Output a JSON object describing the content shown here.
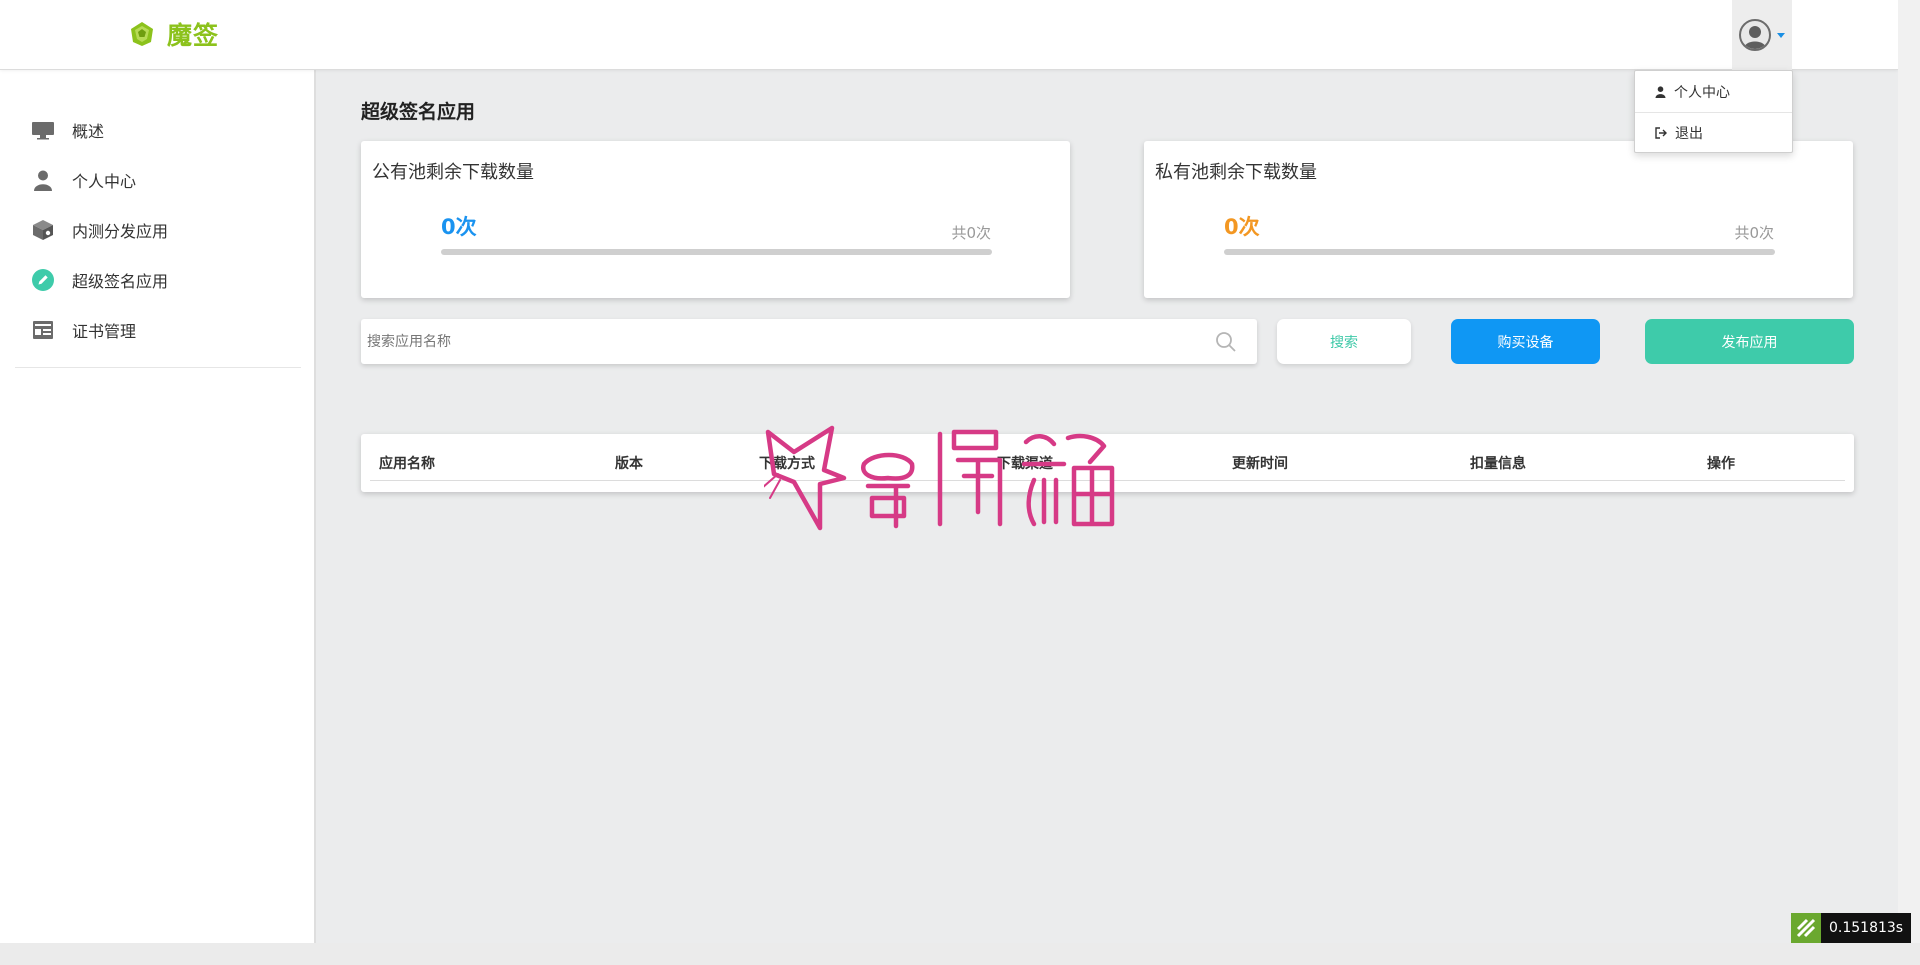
{
  "app": {
    "name": "魔签",
    "brand_color": "#8cc21c"
  },
  "user_menu": {
    "items": [
      {
        "label": "个人中心",
        "icon": "user-icon"
      },
      {
        "label": "退出",
        "icon": "logout-icon"
      }
    ]
  },
  "sidebar": {
    "items": [
      {
        "label": "概述",
        "icon": "monitor-icon"
      },
      {
        "label": "个人中心",
        "icon": "user-icon"
      },
      {
        "label": "内测分发应用",
        "icon": "box-icon"
      },
      {
        "label": "超级签名应用",
        "icon": "pencil-icon",
        "active": true
      },
      {
        "label": "证书管理",
        "icon": "certificate-icon"
      }
    ]
  },
  "main": {
    "title": "超级签名应用",
    "public_pool": {
      "title": "公有池剩余下载数量",
      "count": "0次",
      "total": "共0次",
      "color": "#1a93f0",
      "fill": 0
    },
    "private_pool": {
      "title": "私有池剩余下载数量",
      "count": "0次",
      "total": "共0次",
      "color": "#f39722",
      "fill": 0
    },
    "search": {
      "placeholder": "搜索应用名称",
      "value": ""
    },
    "buttons": {
      "search": "搜索",
      "buy": "购买设备",
      "publish": "发布应用"
    },
    "table": {
      "columns": [
        "应用名称",
        "版本",
        "下载方式",
        "下载渠道",
        "更新时间",
        "扣量信息",
        "操作"
      ],
      "rows": []
    }
  },
  "watermark": {
    "text": "奇偶猫",
    "color": "#d63a86"
  },
  "debug": {
    "time": "0.151813s"
  }
}
